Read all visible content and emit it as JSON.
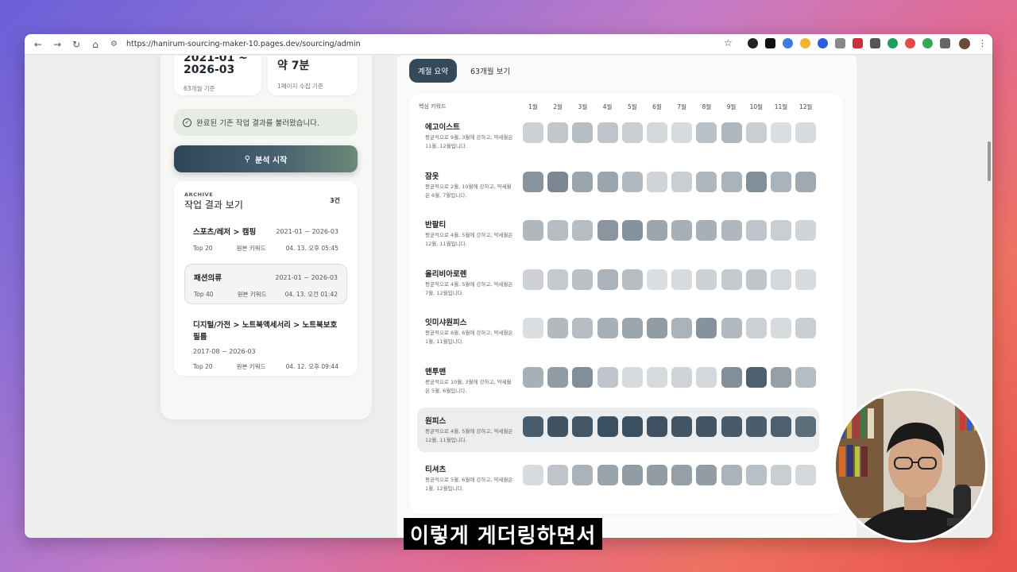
{
  "browser": {
    "url": "https://hanirum-sourcing-maker-10.pages.dev/sourcing/admin"
  },
  "left": {
    "stats": [
      {
        "value": "2021-01 ~\n2026-03",
        "sub": "63개월 기준"
      },
      {
        "value": "약 7분",
        "sub": "1페이지 수집 기준"
      }
    ],
    "notice": "완료된 기존 작업 결과를 불러왔습니다.",
    "analyze_button": "분석 시작",
    "archive": {
      "eyebrow": "ARCHIVE",
      "title": "작업 결과 보기",
      "count": "3건",
      "jobs": [
        {
          "title": "스포츠/레저 > 캠핑",
          "period": "2021-01 ~ 2026-03",
          "top": "Top 20",
          "kw": "원본 키워드",
          "date": "04. 13. 오후 05:45"
        },
        {
          "title": "패션의류",
          "period": "2021-01 ~ 2026-03",
          "top": "Top 40",
          "kw": "원본 키워드",
          "date": "04. 13. 오전 01:42"
        },
        {
          "title": "디지털/가전 > 노트북액세서리 > 노트북보호필름",
          "period": "2017-08 ~ 2026-03",
          "top": "Top 20",
          "kw": "원본 키워드",
          "date": "04. 12. 오후 09:44"
        }
      ]
    }
  },
  "right": {
    "tabs": [
      "계절 요약",
      "63개월 보기"
    ],
    "active_tab": 0,
    "header_label": "핵심 키워드",
    "months": [
      "1월",
      "2월",
      "3월",
      "4월",
      "5월",
      "6월",
      "7월",
      "8월",
      "9월",
      "10월",
      "11월",
      "12월"
    ],
    "rows": [
      {
        "name": "에고이스트",
        "desc": "평균적으로 9월, 3월에 강하고, 약세월은 11월, 12월입니다.",
        "values": [
          0.18,
          0.24,
          0.3,
          0.26,
          0.2,
          0.14,
          0.12,
          0.28,
          0.34,
          0.2,
          0.1,
          0.12
        ]
      },
      {
        "name": "잠옷",
        "desc": "평균적으로 2월, 10월에 강하고, 약세월은 6월, 7월입니다.",
        "values": [
          0.55,
          0.62,
          0.44,
          0.44,
          0.32,
          0.16,
          0.2,
          0.34,
          0.36,
          0.58,
          0.36,
          0.42
        ]
      },
      {
        "name": "반팔티",
        "desc": "평균적으로 4월, 5월에 강하고, 약세월은 12월, 11월입니다.",
        "values": [
          0.34,
          0.3,
          0.3,
          0.54,
          0.56,
          0.44,
          0.38,
          0.38,
          0.34,
          0.26,
          0.2,
          0.16
        ]
      },
      {
        "name": "올리비아로렌",
        "desc": "평균적으로 4월, 5월에 강하고, 약세월은 7월, 12월입니다.",
        "values": [
          0.18,
          0.22,
          0.28,
          0.36,
          0.3,
          0.1,
          0.12,
          0.18,
          0.22,
          0.26,
          0.14,
          0.12
        ]
      },
      {
        "name": "잇미샤원피스",
        "desc": "평균적으로 8월, 6월에 강하고, 약세월은 1월, 11월입니다.",
        "values": [
          0.1,
          0.32,
          0.3,
          0.38,
          0.44,
          0.5,
          0.36,
          0.56,
          0.32,
          0.18,
          0.12,
          0.2
        ]
      },
      {
        "name": "맨투맨",
        "desc": "평균적으로 10월, 3월에 강하고, 약세월은 5월, 6월입니다.",
        "values": [
          0.38,
          0.5,
          0.58,
          0.26,
          0.12,
          0.12,
          0.16,
          0.14,
          0.58,
          0.86,
          0.48,
          0.3
        ]
      },
      {
        "name": "원피스",
        "desc": "평균적으로 4월, 5월에 강하고, 약세월은 12월, 11월입니다.",
        "values": [
          0.88,
          0.94,
          0.92,
          0.96,
          0.96,
          0.95,
          0.93,
          0.93,
          0.9,
          0.88,
          0.86,
          0.78
        ]
      },
      {
        "name": "티셔츠",
        "desc": "평균적으로 5월, 6월에 강하고, 약세월은 1월, 12월입니다.",
        "values": [
          0.12,
          0.26,
          0.36,
          0.46,
          0.5,
          0.5,
          0.48,
          0.5,
          0.36,
          0.28,
          0.2,
          0.14
        ]
      }
    ]
  },
  "caption": "이렇게 게더링하면서",
  "colors": {
    "cell_low": "#eeeff0",
    "cell_high": "#34495a"
  }
}
